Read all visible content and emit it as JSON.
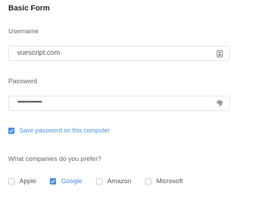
{
  "form": {
    "title": "Basic Form",
    "username": {
      "label": "Username",
      "value": "vuescript.com",
      "icon": "id-card-icon"
    },
    "password": {
      "label": "Password",
      "value": "••••••••••••••",
      "icon": "fingerprint-icon"
    },
    "save_password": {
      "label": "Save password on this computer",
      "checked": true
    },
    "companies": {
      "question": "What companies do you prefer?",
      "options": [
        {
          "label": "Apple",
          "checked": false
        },
        {
          "label": "Google",
          "checked": true
        },
        {
          "label": "Amazon",
          "checked": false
        },
        {
          "label": "Microsoft",
          "checked": false
        }
      ]
    },
    "accent_color": "#4a90e2"
  }
}
